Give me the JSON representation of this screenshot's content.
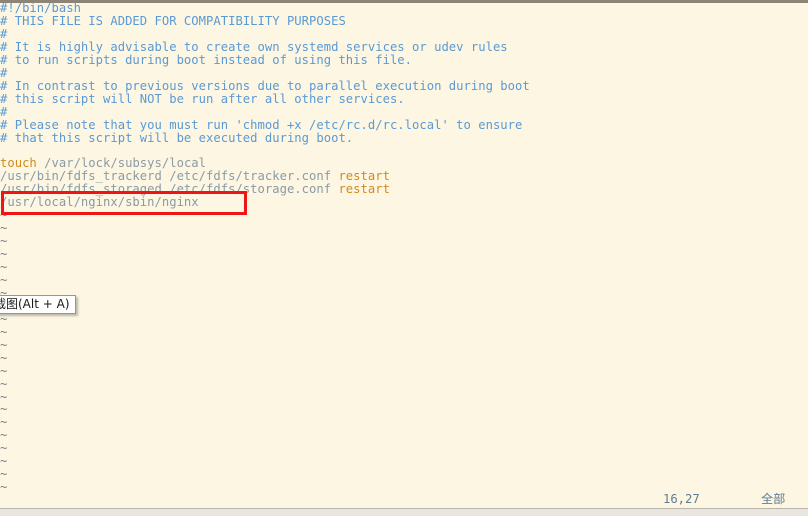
{
  "app": {
    "kind": "vim-terminal-editor",
    "background_color": "#fdf6e3",
    "comment_color": "#5a9ad4",
    "path_color": "#8a9ba5",
    "keyword_color": "#d08b1e",
    "tilde_color": "#7a7f86",
    "annotation_color": "#f01414"
  },
  "buffer": {
    "lines": [
      {
        "n": 1,
        "segments": [
          {
            "text": "#!/bin/bash",
            "style": "comment"
          }
        ]
      },
      {
        "n": 2,
        "segments": [
          {
            "text": "# THIS FILE IS ADDED FOR COMPATIBILITY PURPOSES",
            "style": "comment"
          }
        ]
      },
      {
        "n": 3,
        "segments": [
          {
            "text": "#",
            "style": "comment"
          }
        ]
      },
      {
        "n": 4,
        "segments": [
          {
            "text": "# It is highly advisable to create own systemd services or udev rules",
            "style": "comment"
          }
        ]
      },
      {
        "n": 5,
        "segments": [
          {
            "text": "# to run scripts during boot instead of using this file.",
            "style": "comment"
          }
        ]
      },
      {
        "n": 6,
        "segments": [
          {
            "text": "#",
            "style": "comment"
          }
        ]
      },
      {
        "n": 7,
        "segments": [
          {
            "text": "# In contrast to previous versions due to parallel execution during boot",
            "style": "comment"
          }
        ]
      },
      {
        "n": 8,
        "segments": [
          {
            "text": "# this script will NOT be run after all other services.",
            "style": "comment"
          }
        ]
      },
      {
        "n": 9,
        "segments": [
          {
            "text": "#",
            "style": "comment"
          }
        ]
      },
      {
        "n": 10,
        "segments": [
          {
            "text": "# Please note that you must run 'chmod +x /etc/rc.d/rc.local' to ensure",
            "style": "comment"
          }
        ]
      },
      {
        "n": 11,
        "segments": [
          {
            "text": "# that this script will be executed during boot.",
            "style": "comment"
          }
        ]
      },
      {
        "n": 12,
        "segments": [
          {
            "text": "",
            "style": "path"
          }
        ]
      },
      {
        "n": 13,
        "segments": [
          {
            "text": "touch",
            "style": "keyword"
          },
          {
            "text": " /var/lock/subsys/local",
            "style": "path"
          }
        ]
      },
      {
        "n": 14,
        "segments": [
          {
            "text": "/usr/bin/fdfs_trackerd /etc/fdfs/tracker.conf ",
            "style": "path"
          },
          {
            "text": "restart",
            "style": "keyword"
          }
        ]
      },
      {
        "n": 15,
        "segments": [
          {
            "text": "/usr/bin/fdfs_storaged /etc/fdfs/storage.conf ",
            "style": "path"
          },
          {
            "text": "restart",
            "style": "keyword"
          }
        ]
      },
      {
        "n": 16,
        "segments": [
          {
            "text": "/usr/local/nginx/sbin/nginx",
            "style": "path"
          }
        ]
      }
    ],
    "empty_line_marker": "~",
    "empty_line_count": 22
  },
  "annotation": {
    "name": "red-highlight-rectangle",
    "targets_line": 16,
    "target_text": "/usr/local/nginx/sbin/nginx"
  },
  "tooltip": {
    "text": "截图(Alt + A)",
    "clipped_left": true
  },
  "status": {
    "position": "16,27",
    "scroll_indicator": "全部"
  }
}
